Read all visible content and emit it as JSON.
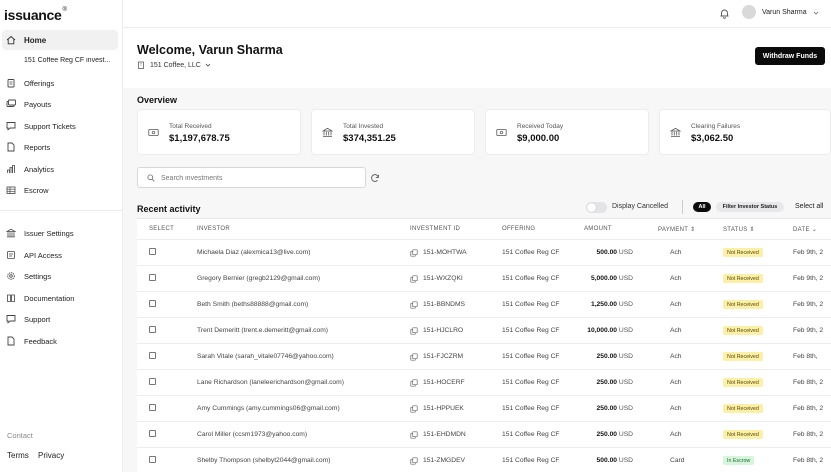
{
  "brand": {
    "name": "issuance",
    "mark": "®"
  },
  "sidebar": {
    "items": [
      {
        "label": "Home",
        "icon": "home-icon"
      },
      {
        "label": "Offerings",
        "icon": "clipboard-icon"
      },
      {
        "label": "Payouts",
        "icon": "payouts-icon"
      },
      {
        "label": "Support Tickets",
        "icon": "message-icon"
      },
      {
        "label": "Reports",
        "icon": "document-icon"
      },
      {
        "label": "Analytics",
        "icon": "bar-chart-icon"
      },
      {
        "label": "Escrow",
        "icon": "table-icon"
      }
    ],
    "sub_item": "151 Coffee Reg CF invest...",
    "items2": [
      {
        "label": "Issuer Settings",
        "icon": "bank-icon"
      },
      {
        "label": "API Access",
        "icon": "api-icon"
      },
      {
        "label": "Settings",
        "icon": "gear-icon"
      },
      {
        "label": "Documentation",
        "icon": "book-icon"
      },
      {
        "label": "Support",
        "icon": "chat-icon"
      },
      {
        "label": "Feedback",
        "icon": "feedback-icon"
      }
    ],
    "contact": "Contact",
    "terms": "Terms",
    "privacy": "Privacy"
  },
  "header": {
    "user_name": "Varun Sharma"
  },
  "page": {
    "welcome": "Welcome, Varun Sharma",
    "company": "151 Coffee, LLC",
    "withdraw_label": "Withdraw Funds",
    "overview_title": "Overview"
  },
  "stats": [
    {
      "label": "Total Received",
      "value": "$1,197,678.75"
    },
    {
      "label": "Total Invested",
      "value": "$374,351.25"
    },
    {
      "label": "Received Today",
      "value": "$9,000.00"
    },
    {
      "label": "Clearing Failures",
      "value": "$3,062.50"
    }
  ],
  "search": {
    "placeholder": "Search investments"
  },
  "recent": {
    "title": "Recent activity",
    "display_cancelled": "Display Cancelled",
    "all_label": "All",
    "filter_label": "Filter Investor Status",
    "select_all": "Select all"
  },
  "table": {
    "headers": {
      "select": "SELECT",
      "investor": "INVESTOR",
      "investment_id": "INVESTMENT ID",
      "offering": "OFFERING",
      "amount": "AMOUNT",
      "payment": "PAYMENT ⇕",
      "status": "STATUS ⇕",
      "date": "DATE ⌄"
    },
    "currency": "USD",
    "rows": [
      {
        "investor": "Michaela Diaz (alexmica13@live.com)",
        "id": "151-MOHTWA",
        "offering": "151 Coffee Reg CF",
        "amount": "500.00",
        "payment": "Ach",
        "status": "Not Received",
        "date": "Feb 9th, 2"
      },
      {
        "investor": "Gregory Bernier (gregb2129@gmail.com)",
        "id": "151-WXZQKI",
        "offering": "151 Coffee Reg CF",
        "amount": "5,000.00",
        "payment": "Ach",
        "status": "Not Received",
        "date": "Feb 9th, 2"
      },
      {
        "investor": "Beth Smith (beths88888@gmail.com)",
        "id": "151-BBNDMS",
        "offering": "151 Coffee Reg CF",
        "amount": "1,250.00",
        "payment": "Ach",
        "status": "Not Received",
        "date": "Feb 9th, 2"
      },
      {
        "investor": "Trent Demeritt (trent.e.demeritt@gmail.com)",
        "id": "151-HJCLRO",
        "offering": "151 Coffee Reg CF",
        "amount": "10,000.00",
        "payment": "Ach",
        "status": "Not Received",
        "date": "Feb 9th, 2"
      },
      {
        "investor": "Sarah Vitale (sarah_vitale07746@yahoo.com)",
        "id": "151-FJCZRM",
        "offering": "151 Coffee Reg CF",
        "amount": "250.00",
        "payment": "Ach",
        "status": "Not Received",
        "date": "Feb 8th,"
      },
      {
        "investor": "Lane Richardson (laneleerichardson@gmail.com)",
        "id": "151-HOCERF",
        "offering": "151 Coffee Reg CF",
        "amount": "250.00",
        "payment": "Ach",
        "status": "Not Received",
        "date": "Feb 8th, 2"
      },
      {
        "investor": "Amy Cummings (amy.cummings06@gmail.com)",
        "id": "151-HPPUEK",
        "offering": "151 Coffee Reg CF",
        "amount": "250.00",
        "payment": "Ach",
        "status": "Not Received",
        "date": "Feb 8th, 2"
      },
      {
        "investor": "Carol Miller (ccsm1973@yahoo.com)",
        "id": "151-EHDMDN",
        "offering": "151 Coffee Reg CF",
        "amount": "250.00",
        "payment": "Ach",
        "status": "Not Received",
        "date": "Feb 8th, 2"
      },
      {
        "investor": "Shelby Thompson (shelbyt2044@gmail.com)",
        "id": "151-ZMGDEV",
        "offering": "151 Coffee Reg CF",
        "amount": "500.00",
        "payment": "Card",
        "status": "In Escrow",
        "date": "Feb 8th, 2"
      }
    ]
  },
  "colors": {
    "primary": "#0b0b0b",
    "not_received_bg": "#fcefa8",
    "escrow_bg": "#d7f5dc",
    "band": "#f7f7f8"
  }
}
